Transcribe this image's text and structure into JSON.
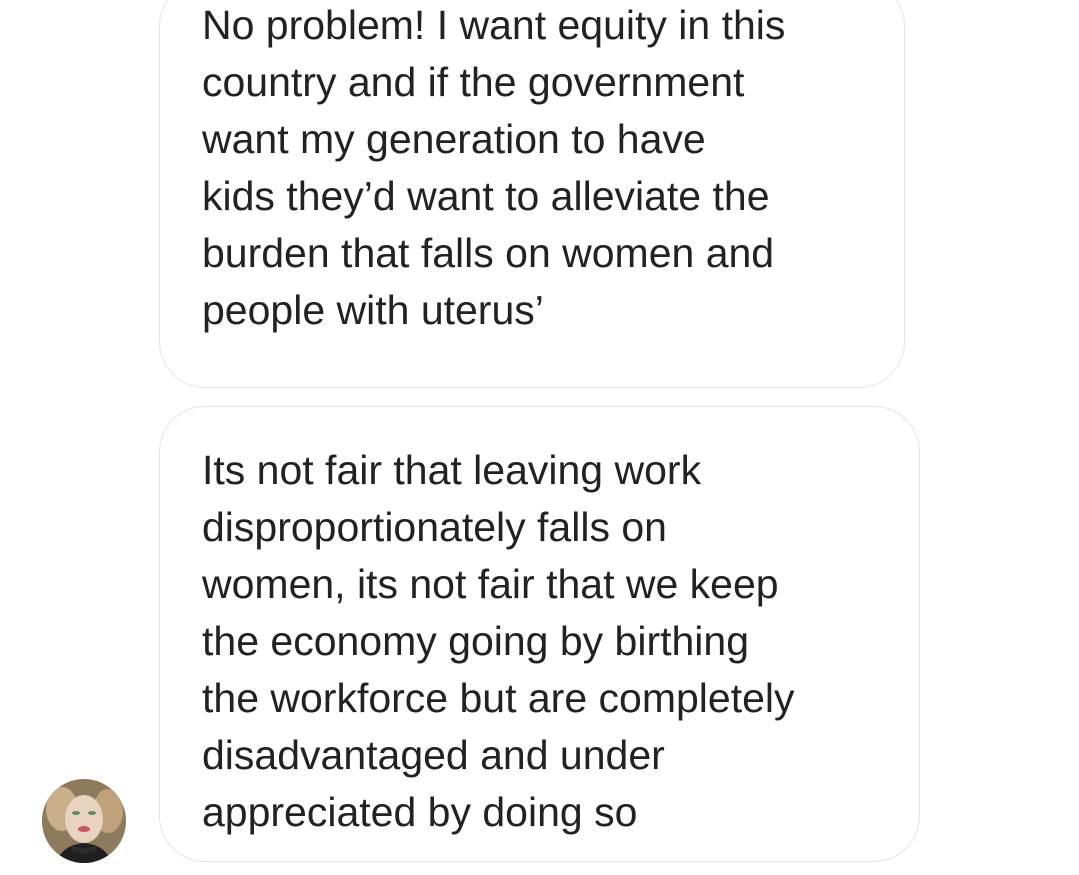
{
  "messages": [
    {
      "lines": [
        "No problem! I want equity in this",
        "country and if the government",
        "want my generation to have",
        "kids they’d want to alleviate the",
        "burden that falls on women and",
        "people with uterus’"
      ]
    },
    {
      "lines": [
        "Its not fair that leaving work",
        "disproportionately falls on",
        "women, its not fair that we keep",
        "the economy going by birthing",
        "the workforce but are completely",
        "disadvantaged and under",
        "appreciated by doing so"
      ]
    }
  ],
  "sender": {
    "avatar_icon": "profile-photo-avatar"
  },
  "colors": {
    "background": "#ffffff",
    "bubble_border": "#e3e3e3",
    "text": "#222222"
  }
}
